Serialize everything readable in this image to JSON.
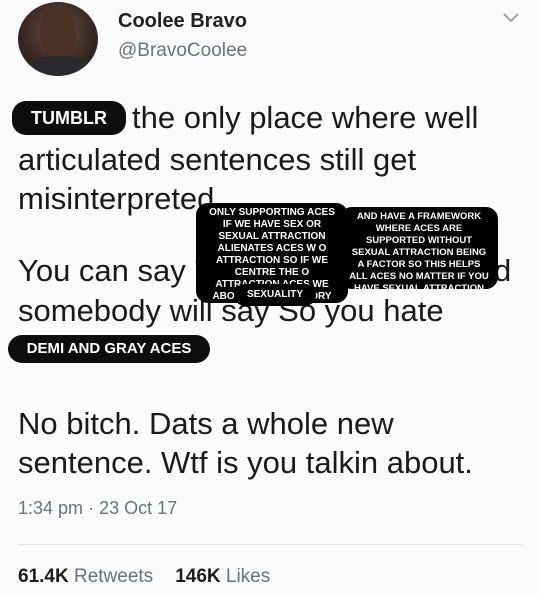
{
  "user": {
    "name": "Coolee Bravo",
    "handle": "@BravoCoolee"
  },
  "tags": {
    "tumblr": "TUMBLR",
    "demi": "DEMI AND GRAY ACES"
  },
  "tweet": {
    "lines": [
      "the only place where well",
      "articulated sentences still get",
      "misinterpreted",
      "You can say \"",
      "d",
      "somebody will say  So you hate",
      "No bitch. Dats a whole new",
      "sentence. Wtf is you talkin about."
    ]
  },
  "overlay_notes": {
    "left": "ONLY SUPPORTING ACES IF WE HAVE SEX OR SEXUAL ATTRACTION ALIENATES ACES W O ATTRACTION SO IF WE CENTRE THE O ATTRACTION ACES WE ABOLISH COMPULSORY",
    "right": "AND HAVE A FRAMEWORK WHERE ACES ARE SUPPORTED WITHOUT SEXUAL ATTRACTION BEING A FACTOR SO THIS HELPS ALL ACES NO MATTER IF YOU HAVE SEXUAL ATTRACTION OR NOT",
    "tail": "SEXUALITY"
  },
  "meta": {
    "time": "1:34 pm",
    "separator": "·",
    "date": "23 Oct 17"
  },
  "stats": {
    "retweets_count": "61.4K",
    "retweets_label": "Retweets",
    "likes_count": "146K",
    "likes_label": "Likes"
  },
  "icons": {
    "more": "chevron-down-icon"
  }
}
